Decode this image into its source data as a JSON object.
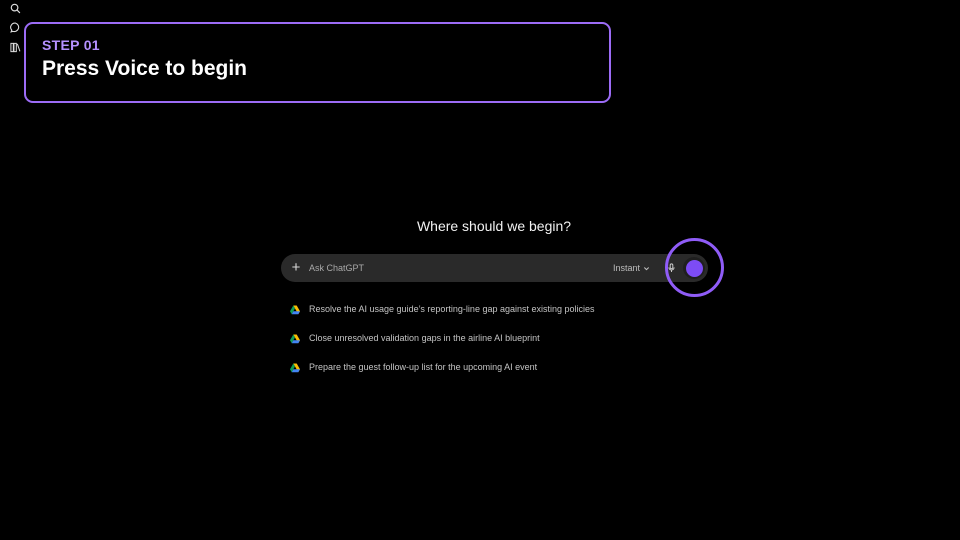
{
  "sidebar": {
    "icons": [
      "search-icon",
      "chat-bubble-icon",
      "library-icon"
    ]
  },
  "callout": {
    "step": "STEP 01",
    "title": "Press Voice to begin",
    "accent": "#9c6cf6"
  },
  "main": {
    "heading": "Where should we begin?",
    "composer": {
      "placeholder": "Ask ChatGPT",
      "mode_label": "Instant",
      "voice_color": "#7d4cf5"
    },
    "suggestions": [
      {
        "icon": "google-drive-icon",
        "label": "Resolve the AI usage guide’s reporting-line gap against existing policies"
      },
      {
        "icon": "google-drive-icon",
        "label": "Close unresolved validation gaps in the airline AI blueprint"
      },
      {
        "icon": "google-drive-icon",
        "label": "Prepare the guest follow-up list for the upcoming AI event"
      }
    ]
  }
}
